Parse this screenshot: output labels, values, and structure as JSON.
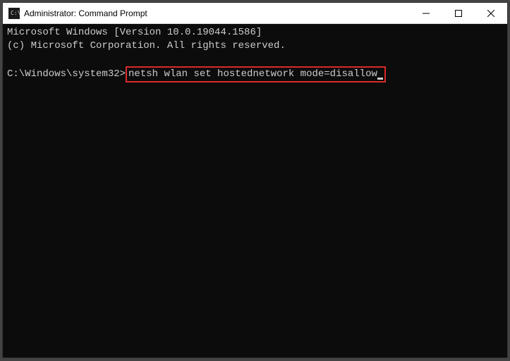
{
  "titlebar": {
    "title": "Administrator: Command Prompt"
  },
  "terminal": {
    "line1": "Microsoft Windows [Version 10.0.19044.1586]",
    "line2": "(c) Microsoft Corporation. All rights reserved.",
    "prompt": "C:\\Windows\\system32>",
    "command": "netsh wlan set hostednetwork mode=disallow"
  }
}
